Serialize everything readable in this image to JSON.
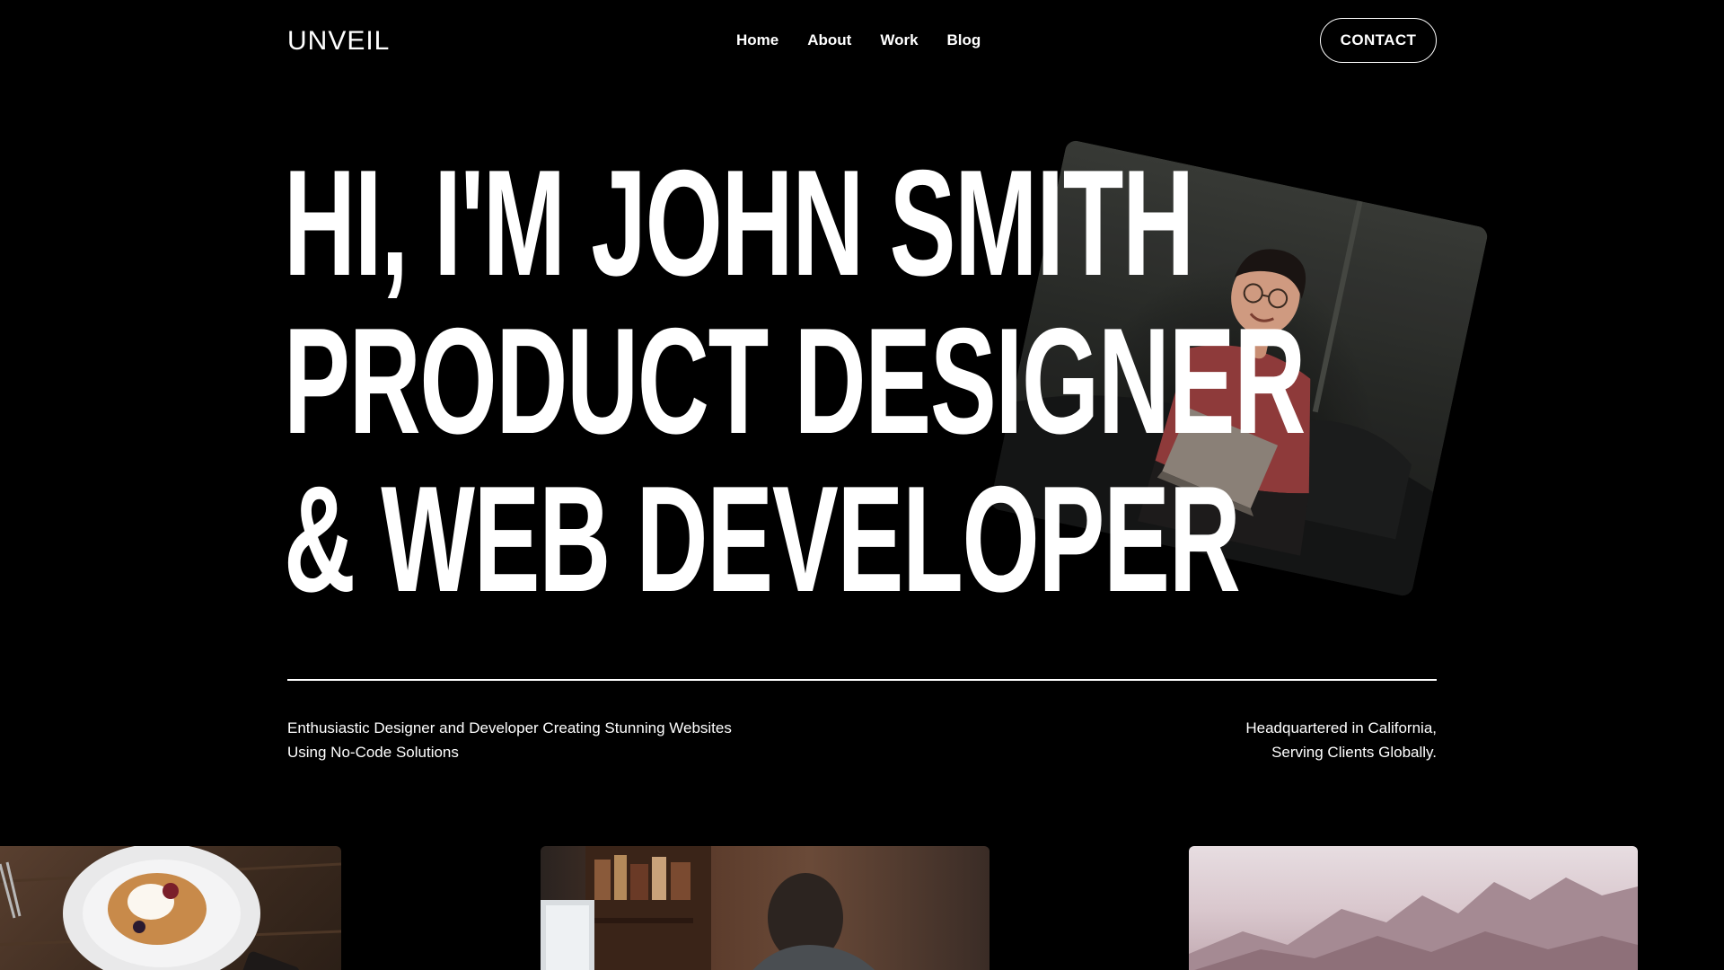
{
  "header": {
    "logo": "UNVEIL",
    "nav": [
      "Home",
      "About",
      "Work",
      "Blog"
    ],
    "contact_label": "CONTACT"
  },
  "hero": {
    "headline_lines": [
      "HI, I'M JOHN SMITH",
      "PRODUCT DESIGNER",
      "& WEB DEVELOPER"
    ],
    "photo_alt": "portrait-photo"
  },
  "intro": {
    "left_lines": [
      "Enthusiastic Designer and Developer Creating Stunning Websites",
      "Using No-Code Solutions"
    ],
    "right_lines": [
      "Headquartered in California,",
      "Serving Clients Globally."
    ]
  },
  "projects": [
    {
      "image": "food-photo"
    },
    {
      "image": "workspace-photo"
    },
    {
      "image": "mountain-photo"
    }
  ],
  "colors": {
    "background": "#000000",
    "text": "#ffffff"
  }
}
